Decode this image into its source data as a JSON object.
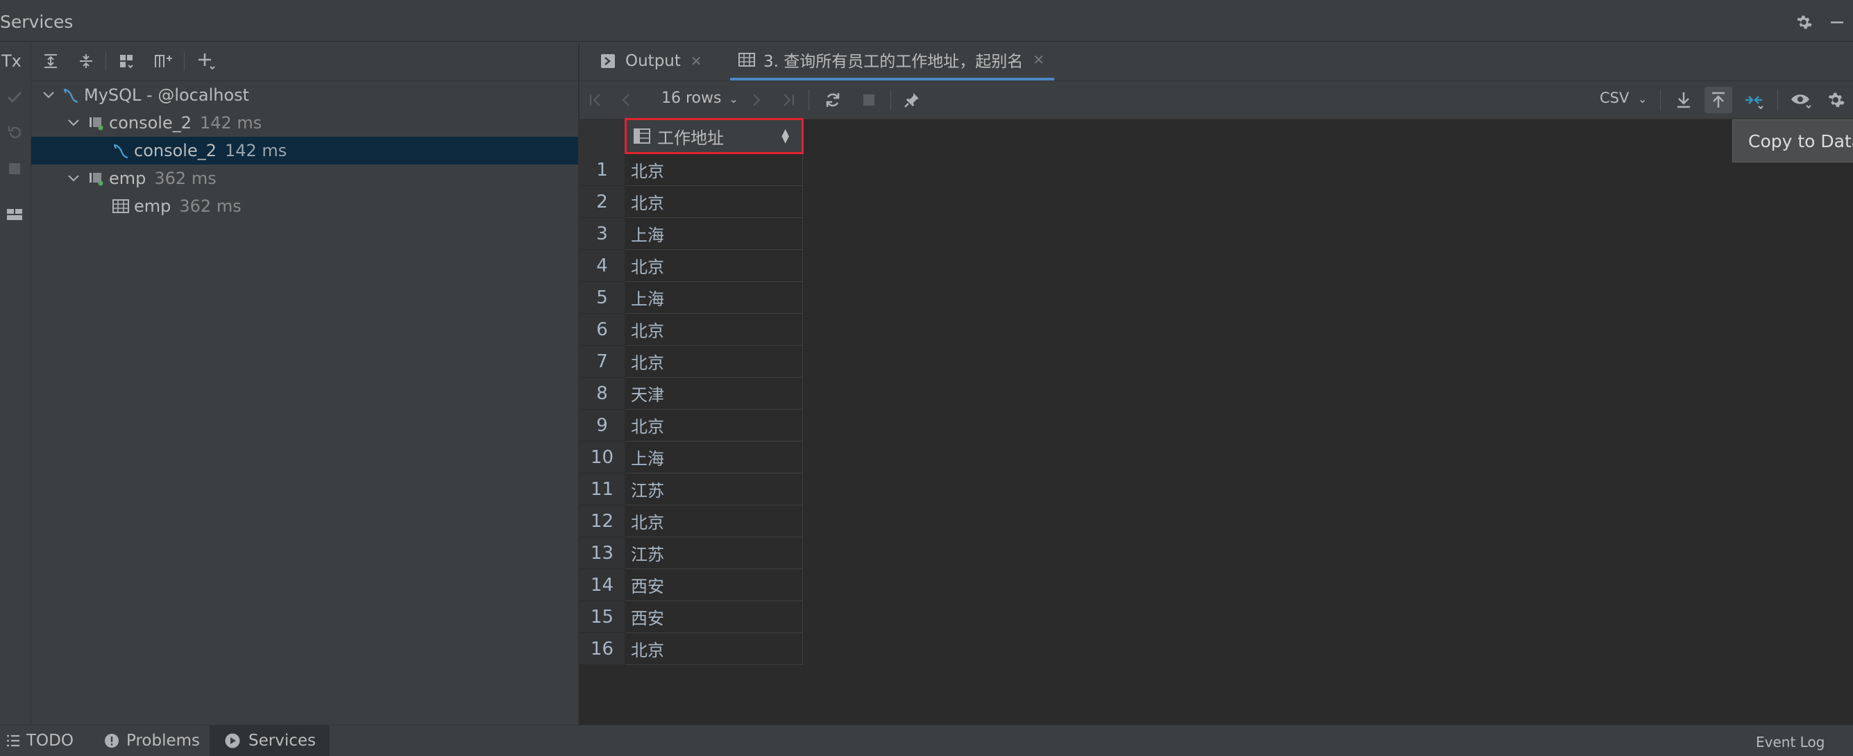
{
  "header": {
    "title": "Services"
  },
  "left_toolbar": {
    "tx_label": "Tx"
  },
  "tree": {
    "items": [
      {
        "label": "MySQL - @localhost",
        "time": ""
      },
      {
        "label": "console_2",
        "time": "142 ms"
      },
      {
        "label": "console_2",
        "time": "142 ms"
      },
      {
        "label": "emp",
        "time": "362 ms"
      },
      {
        "label": "emp",
        "time": "362 ms"
      }
    ]
  },
  "tabs": [
    {
      "label": "Output"
    },
    {
      "label": "3. 查询所有员工的工作地址，起别名"
    }
  ],
  "grid_toolbar": {
    "rows_label": "16 rows",
    "export_format": "CSV"
  },
  "table": {
    "column": "工作地址",
    "rows": [
      {
        "n": "1",
        "v": "北京"
      },
      {
        "n": "2",
        "v": "北京"
      },
      {
        "n": "3",
        "v": "上海"
      },
      {
        "n": "4",
        "v": "北京"
      },
      {
        "n": "5",
        "v": "上海"
      },
      {
        "n": "6",
        "v": "北京"
      },
      {
        "n": "7",
        "v": "北京"
      },
      {
        "n": "8",
        "v": "天津"
      },
      {
        "n": "9",
        "v": "北京"
      },
      {
        "n": "10",
        "v": "上海"
      },
      {
        "n": "11",
        "v": "江苏"
      },
      {
        "n": "12",
        "v": "北京"
      },
      {
        "n": "13",
        "v": "江苏"
      },
      {
        "n": "14",
        "v": "西安"
      },
      {
        "n": "15",
        "v": "西安"
      },
      {
        "n": "16",
        "v": "北京"
      }
    ]
  },
  "tooltip": {
    "text": "Copy to Data"
  },
  "statusbar": {
    "todo": "TODO",
    "problems": "Problems",
    "services": "Services",
    "event_log": "Event Log"
  },
  "colors": {
    "accent": "#4a88c7",
    "highlight_border": "#e0232f",
    "selection": "#0d293e"
  }
}
